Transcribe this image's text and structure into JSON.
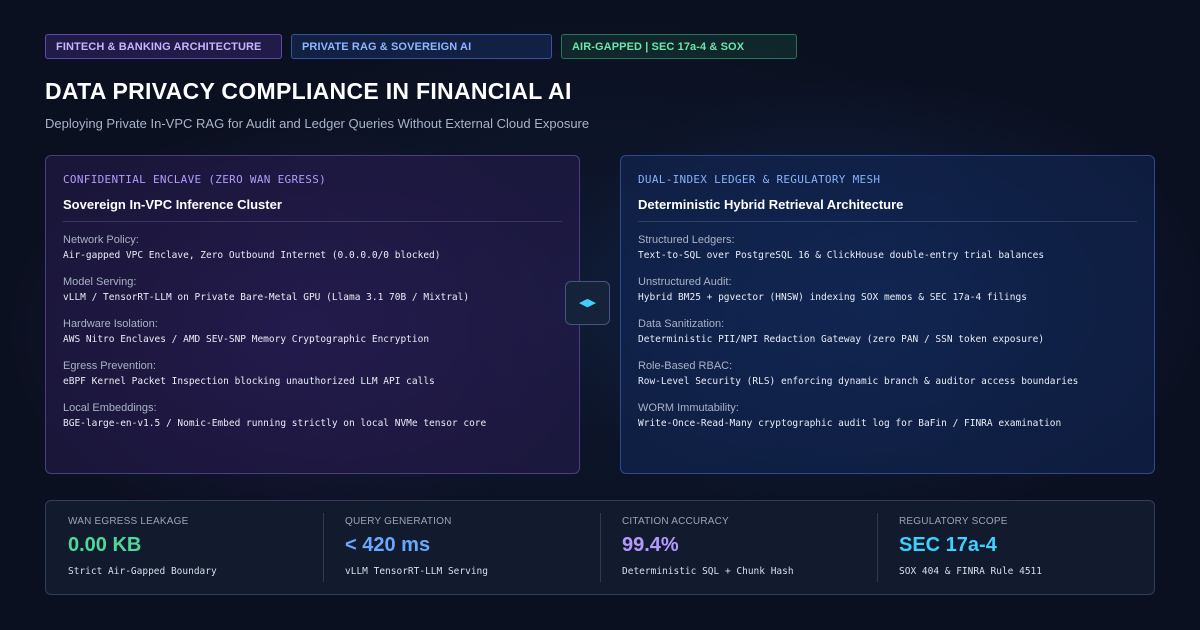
{
  "tags": [
    {
      "label": "FINTECH & BANKING ARCHITECTURE",
      "color": "#c9b3ff"
    },
    {
      "label": "PRIVATE RAG & SOVEREIGN AI",
      "color": "#8fb6ff"
    },
    {
      "label": "AIR-GAPPED | SEC 17a-4 & SOX",
      "color": "#6ee6a6"
    }
  ],
  "header": {
    "title": "DATA PRIVACY COMPLIANCE IN FINANCIAL AI",
    "subtitle": "Deploying Private In-VPC RAG for Audit and Ledger Queries Without External Cloud Exposure"
  },
  "left_panel": {
    "eyebrow": "CONFIDENTIAL ENCLAVE (ZERO WAN EGRESS)",
    "heading": "Sovereign In-VPC Inference Cluster",
    "items": [
      {
        "label": "Network Policy:",
        "value": "Air-gapped VPC Enclave, Zero Outbound Internet (0.0.0.0/0 blocked)"
      },
      {
        "label": "Model Serving:",
        "value": "vLLM / TensorRT-LLM on Private Bare-Metal GPU (Llama 3.1 70B / Mixtral)"
      },
      {
        "label": "Hardware Isolation:",
        "value": "AWS Nitro Enclaves / AMD SEV-SNP Memory Cryptographic Encryption"
      },
      {
        "label": "Egress Prevention:",
        "value": "eBPF Kernel Packet Inspection blocking unauthorized LLM API calls"
      },
      {
        "label": "Local Embeddings:",
        "value": "BGE-large-en-v1.5 / Nomic-Embed running strictly on local NVMe tensor core"
      }
    ]
  },
  "switch": {
    "icon": "bidirectional-arrows-icon",
    "left_glyph": "◀",
    "right_glyph": "▶"
  },
  "right_panel": {
    "eyebrow": "DUAL-INDEX LEDGER & REGULATORY MESH",
    "heading": "Deterministic Hybrid Retrieval Architecture",
    "items": [
      {
        "label": "Structured Ledgers:",
        "value": "Text-to-SQL over PostgreSQL 16 & ClickHouse double-entry trial balances"
      },
      {
        "label": "Unstructured Audit:",
        "value": "Hybrid BM25 + pgvector (HNSW) indexing SOX memos & SEC 17a-4 filings"
      },
      {
        "label": "Data Sanitization:",
        "value": "Deterministic PII/NPI Redaction Gateway (zero PAN / SSN token exposure)"
      },
      {
        "label": "Role-Based RBAC:",
        "value": "Row-Level Security (RLS) enforcing dynamic branch & auditor access boundaries"
      },
      {
        "label": "WORM Immutability:",
        "value": "Write-Once-Read-Many cryptographic audit log for BaFin / FINRA examination"
      }
    ]
  },
  "stats": [
    {
      "label": "WAN EGRESS LEAKAGE",
      "value": "0.00 KB",
      "desc": "Strict Air-Gapped Boundary",
      "color": "#4fd89a"
    },
    {
      "label": "QUERY GENERATION",
      "value": "< 420 ms",
      "desc": "vLLM TensorRT-LLM Serving",
      "color": "#6aa8ff"
    },
    {
      "label": "CITATION ACCURACY",
      "value": "99.4%",
      "desc": "Deterministic SQL + Chunk Hash",
      "color": "#b49aff"
    },
    {
      "label": "REGULATORY SCOPE",
      "value": "SEC 17a-4",
      "desc": "SOX 404 & FINRA Rule 4511",
      "color": "#3fd0ff"
    }
  ]
}
